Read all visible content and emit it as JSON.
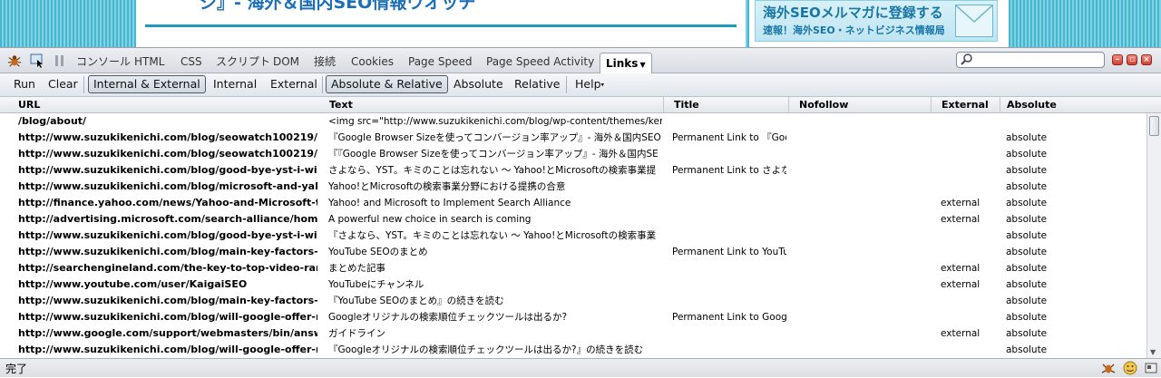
{
  "webpage": {
    "heading": "ジ』- 海外＆国内SEO情報ウオッチ",
    "banner_title": "海外SEOメルマガに登録する",
    "banner_sub": "速報！海外SEO・ネットビジネス情報局"
  },
  "firebug": {
    "tabs": [
      {
        "label": "コンソール",
        "active": false
      },
      {
        "label": "HTML",
        "active": false
      },
      {
        "label": "CSS",
        "active": false
      },
      {
        "label": "スクリプト",
        "active": false
      },
      {
        "label": "DOM",
        "active": false
      },
      {
        "label": "接続",
        "active": false
      },
      {
        "label": "Cookies",
        "active": false
      },
      {
        "label": "Page Speed",
        "active": false
      },
      {
        "label": "Page Speed Activity",
        "active": false
      },
      {
        "label": "Links",
        "active": true
      }
    ],
    "search": {
      "value": "",
      "placeholder": ""
    },
    "icons": {
      "bug": "firebug-icon",
      "inspect": "inspect-icon",
      "pause": "pause-icon",
      "search": "search-icon"
    }
  },
  "toolbar": {
    "run": "Run",
    "clear": "Clear",
    "internal_external": "Internal & External",
    "internal": "Internal",
    "external": "External",
    "absolute_relative": "Absolute & Relative",
    "absolute": "Absolute",
    "relative": "Relative",
    "help": "Help"
  },
  "grid": {
    "columns": [
      "URL",
      "Text",
      "Title",
      "Nofollow",
      "External",
      "Absolute"
    ],
    "rows": [
      {
        "url": "/blog/about/",
        "text": "<img src=\"http://www.suzukikenichi.com/blog/wp-content/themes/keni/imag",
        "title": "",
        "nofollow": "",
        "external": "",
        "absolute": ""
      },
      {
        "url": "http://www.suzukikenichi.com/blog/seowatch100219/",
        "text": "『Google Browser Sizeを使ってコンバージョン率アップ』- 海外＆国内SEO",
        "title": "Permanent Link to 『Goog",
        "nofollow": "",
        "external": "",
        "absolute": "absolute"
      },
      {
        "url": "http://www.suzukikenichi.com/blog/seowatch100219/",
        "text": "『『Google Browser Sizeを使ってコンバージョン率アップ』- 海外＆国内SE",
        "title": "",
        "nofollow": "",
        "external": "",
        "absolute": "absolute"
      },
      {
        "url": "http://www.suzukikenichi.com/blog/good-bye-yst-i-will-n",
        "text": "さよなら、YST。キミのことは忘れない ～ Yahoo!とMicrosoftの検索事業提",
        "title": "Permanent Link to さよな",
        "nofollow": "",
        "external": "",
        "absolute": "absolute"
      },
      {
        "url": "http://www.suzukikenichi.com/blog/microsoft-and-yahoo",
        "text": "Yahoo!とMicrosoftの検索事業分野における提携の合意",
        "title": "",
        "nofollow": "",
        "external": "",
        "absolute": "absolute"
      },
      {
        "url": "http://finance.yahoo.com/news/Yahoo-and-Microsoft-to-I",
        "text": "Yahoo! and Microsoft to Implement Search Alliance",
        "title": "",
        "nofollow": "",
        "external": "external",
        "absolute": "absolute"
      },
      {
        "url": "http://advertising.microsoft.com/search-alliance/home",
        "text": "A powerful new choice in search is coming",
        "title": "",
        "nofollow": "",
        "external": "external",
        "absolute": "absolute"
      },
      {
        "url": "http://www.suzukikenichi.com/blog/good-bye-yst-i-will-n",
        "text": "『さよなら、YST。キミのことは忘れない ～ Yahoo!とMicrosoftの検索事業",
        "title": "",
        "nofollow": "",
        "external": "",
        "absolute": "absolute"
      },
      {
        "url": "http://www.suzukikenichi.com/blog/main-key-factors-of-",
        "text": "YouTube SEOのまとめ",
        "title": "Permanent Link to YouTub",
        "nofollow": "",
        "external": "",
        "absolute": "absolute"
      },
      {
        "url": "http://searchengineland.com/the-key-to-top-video-ranki",
        "text": "まとめた記事",
        "title": "",
        "nofollow": "",
        "external": "external",
        "absolute": "absolute"
      },
      {
        "url": "http://www.youtube.com/user/KaigaiSEO",
        "text": "YouTubeにチャンネル",
        "title": "",
        "nofollow": "",
        "external": "external",
        "absolute": "absolute"
      },
      {
        "url": "http://www.suzukikenichi.com/blog/main-key-factors-of-",
        "text": "『YouTube SEOのまとめ』の続きを読む",
        "title": "",
        "nofollow": "",
        "external": "",
        "absolute": "absolute"
      },
      {
        "url": "http://www.suzukikenichi.com/blog/will-google-offer-rank",
        "text": "Googleオリジナルの検索順位チェックツールは出るか?",
        "title": "Permanent Link to Google",
        "nofollow": "",
        "external": "",
        "absolute": "absolute"
      },
      {
        "url": "http://www.google.com/support/webmasters/bin/answer",
        "text": "ガイドライン",
        "title": "",
        "nofollow": "",
        "external": "external",
        "absolute": "absolute"
      },
      {
        "url": "http://www.suzukikenichi.com/blog/will-google-offer-rank",
        "text": "『Googleオリジナルの検索順位チェックツールは出るか?』の続きを読む",
        "title": "",
        "nofollow": "",
        "external": "",
        "absolute": "absolute"
      }
    ]
  },
  "statusbar": {
    "text": "完了"
  },
  "colors": {
    "accent": "#1c6fb6",
    "page_bg": "#47b7cf"
  }
}
